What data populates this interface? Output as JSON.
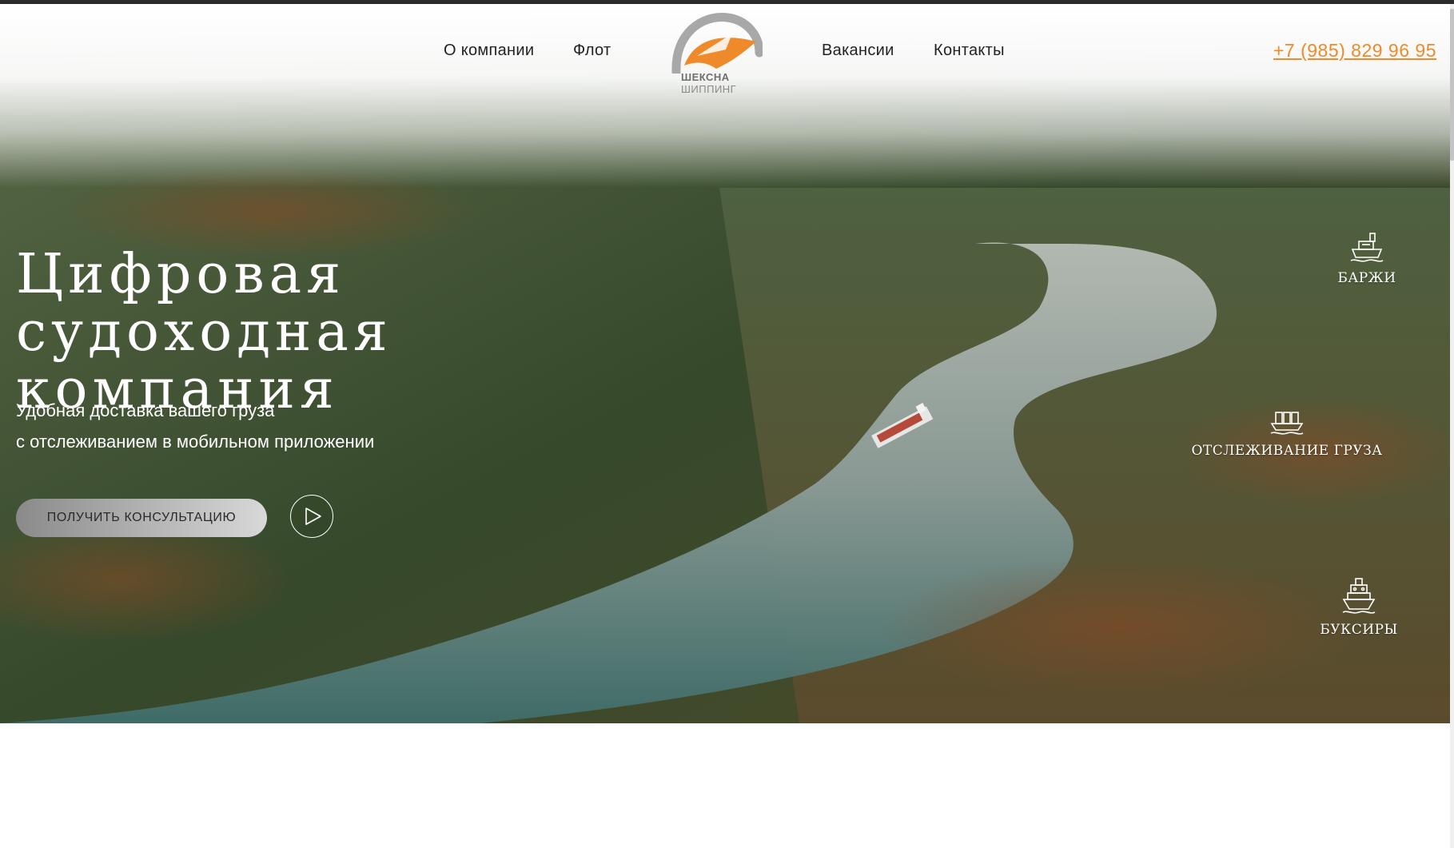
{
  "nav": {
    "left": [
      "О компании",
      "Флот"
    ],
    "right": [
      "Вакансии",
      "Контакты"
    ],
    "phone": "+7 (985) 829 96 95"
  },
  "logo": {
    "line1": "ШЕКСНА",
    "line2": "ШИППИНГ"
  },
  "hero": {
    "title_line1": "Цифровая судоходная",
    "title_line2": "компания",
    "subtitle_line1": "Удобная доставка вашего груза",
    "subtitle_line2": "с отслеживанием в мобильном приложении",
    "cta_label": "ПОЛУЧИТЬ КОНСУЛЬТАЦИЮ"
  },
  "services": [
    {
      "label": "БАРЖИ",
      "icon": "barge-icon"
    },
    {
      "label": "ОТСЛЕЖИВАНИЕ ГРУЗА",
      "icon": "cargo-ship-icon"
    },
    {
      "label": "БУКСИРЫ",
      "icon": "tugboat-icon"
    }
  ],
  "colors": {
    "accent": "#ef8a2b",
    "logo_gray": "#8a8a8a"
  }
}
